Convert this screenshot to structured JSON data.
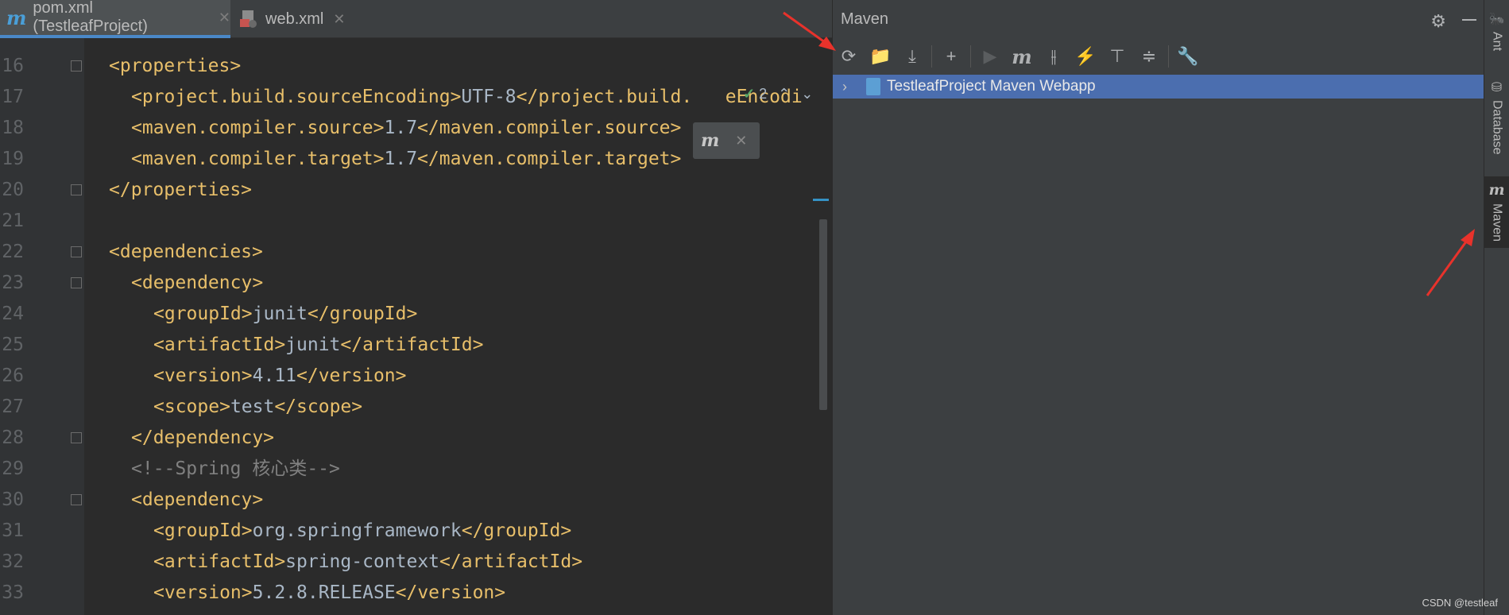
{
  "tabs": [
    {
      "label": "pom.xml (TestleafProject)",
      "icon": "maven-m-icon",
      "active": true
    },
    {
      "label": "web.xml",
      "icon": "xml-file-icon",
      "active": false
    }
  ],
  "editor": {
    "inspection_count": "2",
    "lines": [
      {
        "n": "16",
        "indent": 0,
        "parts": [
          [
            "tag",
            "<properties>"
          ]
        ],
        "fold": true
      },
      {
        "n": "17",
        "indent": 1,
        "parts": [
          [
            "tag",
            "<project.build.sourceEncoding>"
          ],
          [
            "txt",
            "UTF-8"
          ],
          [
            "tag",
            "</project.build."
          ],
          [
            "txt",
            "   "
          ],
          [
            "tag",
            "eEncodi"
          ]
        ],
        "fold": false
      },
      {
        "n": "18",
        "indent": 1,
        "parts": [
          [
            "tag",
            "<maven.compiler.source>"
          ],
          [
            "txt",
            "1.7"
          ],
          [
            "tag",
            "</maven.compiler.source>"
          ]
        ],
        "fold": false
      },
      {
        "n": "19",
        "indent": 1,
        "parts": [
          [
            "tag",
            "<maven.compiler.target>"
          ],
          [
            "txt",
            "1.7"
          ],
          [
            "tag",
            "</maven.compiler.target>"
          ]
        ],
        "fold": false
      },
      {
        "n": "20",
        "indent": 0,
        "parts": [
          [
            "tag",
            "</properties>"
          ]
        ],
        "fold": true
      },
      {
        "n": "21",
        "indent": 0,
        "parts": [],
        "fold": false
      },
      {
        "n": "22",
        "indent": 0,
        "parts": [
          [
            "tag",
            "<dependencies>"
          ]
        ],
        "fold": true
      },
      {
        "n": "23",
        "indent": 1,
        "parts": [
          [
            "tag",
            "<dependency>"
          ]
        ],
        "fold": true
      },
      {
        "n": "24",
        "indent": 2,
        "parts": [
          [
            "tag",
            "<groupId>"
          ],
          [
            "txt",
            "junit"
          ],
          [
            "tag",
            "</groupId>"
          ]
        ],
        "fold": false
      },
      {
        "n": "25",
        "indent": 2,
        "parts": [
          [
            "tag",
            "<artifactId>"
          ],
          [
            "txt",
            "junit"
          ],
          [
            "tag",
            "</artifactId>"
          ]
        ],
        "fold": false
      },
      {
        "n": "26",
        "indent": 2,
        "parts": [
          [
            "tag",
            "<version>"
          ],
          [
            "txt",
            "4.11"
          ],
          [
            "tag",
            "</version>"
          ]
        ],
        "fold": false
      },
      {
        "n": "27",
        "indent": 2,
        "parts": [
          [
            "tag",
            "<scope>"
          ],
          [
            "txt",
            "test"
          ],
          [
            "tag",
            "</scope>"
          ]
        ],
        "fold": false
      },
      {
        "n": "28",
        "indent": 1,
        "parts": [
          [
            "tag",
            "</dependency>"
          ]
        ],
        "fold": true
      },
      {
        "n": "29",
        "indent": 1,
        "parts": [
          [
            "cmt",
            "<!--Spring 核心类-->"
          ]
        ],
        "fold": false
      },
      {
        "n": "30",
        "indent": 1,
        "parts": [
          [
            "tag",
            "<dependency>"
          ]
        ],
        "fold": true
      },
      {
        "n": "31",
        "indent": 2,
        "parts": [
          [
            "tag",
            "<groupId>"
          ],
          [
            "txt",
            "org.springframework"
          ],
          [
            "tag",
            "</groupId>"
          ]
        ],
        "fold": false
      },
      {
        "n": "32",
        "indent": 2,
        "parts": [
          [
            "tag",
            "<artifactId>"
          ],
          [
            "txt",
            "spring-context"
          ],
          [
            "tag",
            "</artifactId>"
          ]
        ],
        "fold": false
      },
      {
        "n": "33",
        "indent": 2,
        "parts": [
          [
            "tag",
            "<version>"
          ],
          [
            "txt",
            "5.2.8.RELEASE"
          ],
          [
            "tag",
            "</version>"
          ]
        ],
        "fold": false
      }
    ]
  },
  "maven": {
    "title": "Maven",
    "toolbar": [
      {
        "name": "reload-all-icon",
        "glyph": "⟳"
      },
      {
        "name": "add-folder-icon",
        "glyph": "📁"
      },
      {
        "name": "download-icon",
        "glyph": "⤓"
      },
      {
        "name": "sep"
      },
      {
        "name": "add-icon",
        "glyph": "+"
      },
      {
        "name": "sep"
      },
      {
        "name": "run-icon",
        "glyph": "▶",
        "disabled": true
      },
      {
        "name": "execute-goal-icon",
        "glyph": "m",
        "m": true
      },
      {
        "name": "toggle-offline-icon",
        "glyph": "⫲"
      },
      {
        "name": "skip-tests-icon",
        "glyph": "⚡",
        "blue": true
      },
      {
        "name": "show-dependencies-icon",
        "glyph": "⊤"
      },
      {
        "name": "collapse-all-icon",
        "glyph": "≑"
      },
      {
        "name": "sep"
      },
      {
        "name": "settings-wrench-icon",
        "glyph": "🔧"
      }
    ],
    "tree": [
      {
        "label": "TestleafProject Maven Webapp"
      }
    ]
  },
  "stripe": [
    {
      "label": "Ant",
      "icon": "ant-icon"
    },
    {
      "label": "Database",
      "icon": "database-icon"
    },
    {
      "label": "Maven",
      "icon": "maven-m-icon",
      "active": true
    }
  ],
  "watermark": "CSDN @testleaf",
  "colors": {
    "accent": "#4b6eaf",
    "tag": "#e8bf6a",
    "arrow": "#e8322b"
  }
}
